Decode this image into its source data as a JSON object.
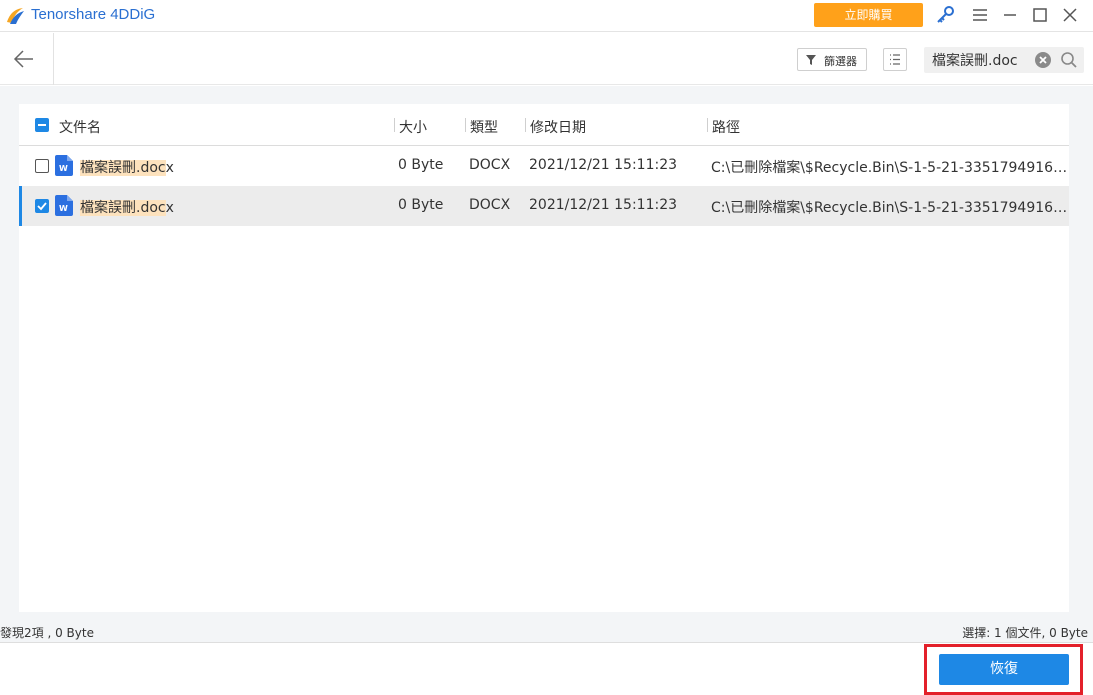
{
  "app": {
    "title": "Tenorshare 4DDiG",
    "buy_label": "立即購買",
    "brand_color": "#2a6fd1",
    "buy_color": "#ffa11a"
  },
  "titlebar_icons": [
    "key-icon",
    "menu-icon",
    "minimize-icon",
    "maximize-icon",
    "close-icon"
  ],
  "toolbar": {
    "filter_label": "篩選器",
    "search_value": "檔案誤刪.doc"
  },
  "table": {
    "columns": [
      "文件名",
      "大小",
      "類型",
      "修改日期",
      "路徑"
    ],
    "rows": [
      {
        "checked": false,
        "name_highlight": "檔案誤刪.doc",
        "name_rest": "x",
        "size": "0 Byte",
        "type": "DOCX",
        "modified": "2021/12/21 15:11:23",
        "path": "C:\\已刪除檔案\\$Recycle.Bin\\S-1-5-21-3351794916-5..."
      },
      {
        "checked": true,
        "name_highlight": "檔案誤刪.doc",
        "name_rest": "x",
        "size": "0 Byte",
        "type": "DOCX",
        "modified": "2021/12/21 15:11:23",
        "path": "C:\\已刪除檔案\\$Recycle.Bin\\S-1-5-21-3351794916-5..."
      }
    ]
  },
  "status": {
    "found": "發現2項 , 0 Byte",
    "selected": "選擇: 1 個文件, 0 Byte"
  },
  "footer": {
    "recover_label": "恢復",
    "accent": "#1e88e5",
    "highlight_color": "#e3202a"
  }
}
